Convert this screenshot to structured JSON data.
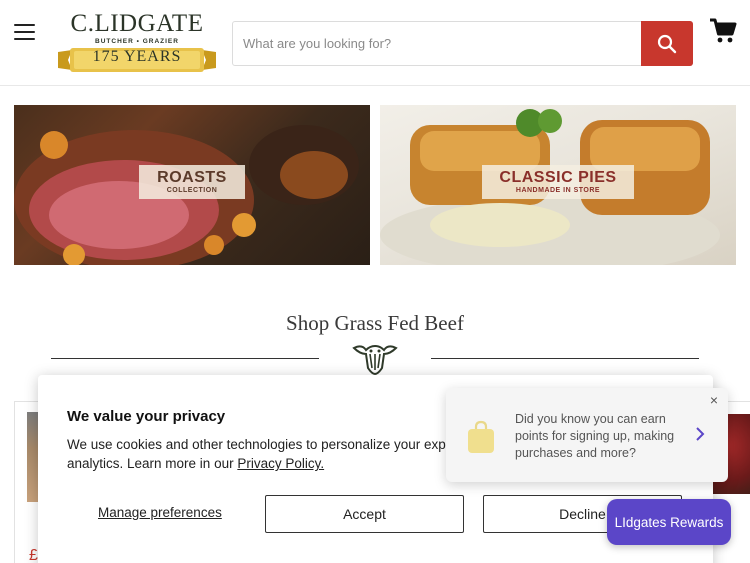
{
  "header": {
    "logo": {
      "name": "C.LIDGATE",
      "tagline": "BUTCHER • GRAZIER",
      "years": "175 YEARS"
    },
    "search_placeholder": "What are you looking for?",
    "menu_icon": "hamburger-icon",
    "search_icon": "search-icon",
    "cart_icon": "cart-icon",
    "accent_color": "#c8372d"
  },
  "banners": [
    {
      "title": "ROASTS",
      "subtitle": "COLLECTION"
    },
    {
      "title": "CLASSIC PIES",
      "subtitle": "HANDMADE IN STORE"
    }
  ],
  "section": {
    "title": "Shop Grass Fed Beef",
    "divider_icon": "cow-head-icon"
  },
  "products": [
    {
      "price_visible": "£"
    }
  ],
  "cookie_banner": {
    "title": "We value your privacy",
    "text": "We use cookies and other technologies to personalize your experience, perform marketing, and collect analytics. Learn more in our ",
    "text_visible_line1": "We use cookies and other technologies to personalize your exper",
    "text_visible_line2": "analytics. Learn more in our ",
    "privacy_link": "Privacy Policy.",
    "manage_label": "Manage preferences",
    "accept_label": "Accept",
    "decline_label": "Decline"
  },
  "rewards": {
    "popup_text": "Did you know you can earn points for signing up, making purchases and more?",
    "close_label": "×",
    "launcher_label": "LIdgates Rewards",
    "launcher_color": "#5b46c8"
  }
}
